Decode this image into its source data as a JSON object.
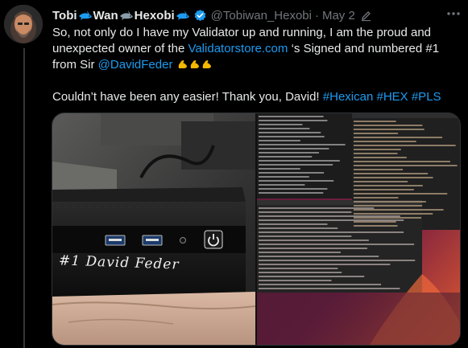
{
  "tweet": {
    "author": {
      "name_parts": [
        "Tobi",
        "Wan",
        "Hexobi"
      ],
      "handle": "@Tobiwan_Hexobi",
      "verified": true
    },
    "separator": "·",
    "date": "May 2",
    "text": {
      "line1_a": "So, not only do I have my Validator up and running, I am the proud and unexpected owner of the ",
      "link_site": "Validatorstore.com",
      "line1_b": " ‘s Signed and numbered #1 from Sir ",
      "mention": "@DavidFeder",
      "line2_a": "Couldn’t have been any easier! Thank you, David! ",
      "hashtags": [
        "#Hexican",
        "#HEX",
        "#PLS"
      ]
    },
    "media": {
      "signature_text": "#1 David Feder"
    }
  },
  "colors": {
    "background": "#000000",
    "text": "#e7e9ea",
    "muted": "#71767b",
    "link": "#1d9bf0",
    "verified": "#1d9bf0",
    "border": "#2f3336"
  },
  "icons": [
    "shark-emoji",
    "verified-badge-icon",
    "edit-icon",
    "more-icon",
    "flexed-biceps-emoji",
    "power-icon"
  ]
}
